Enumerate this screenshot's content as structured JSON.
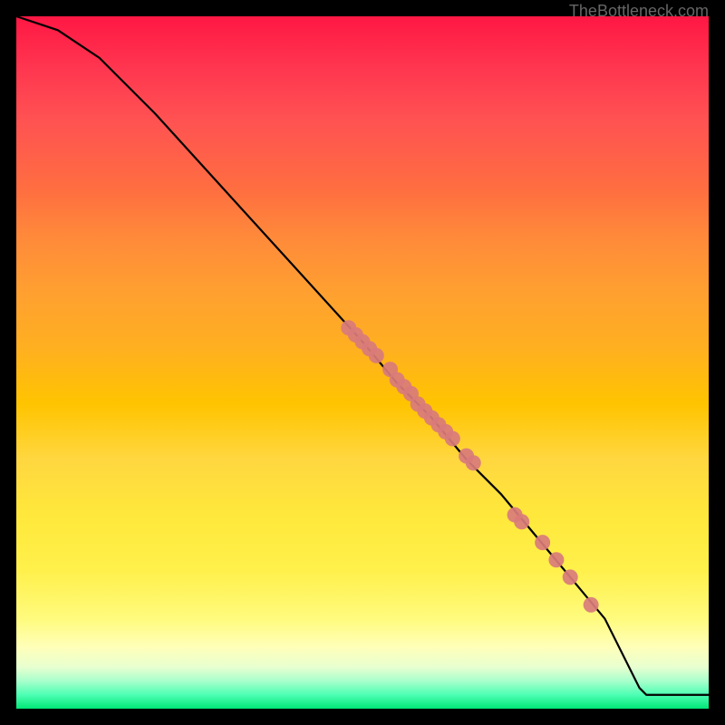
{
  "watermark": "TheBottleneck.com",
  "chart_data": {
    "type": "line",
    "title": "",
    "xlabel": "",
    "ylabel": "",
    "xlim": [
      0,
      100
    ],
    "ylim": [
      0,
      100
    ],
    "line": {
      "x": [
        0,
        6,
        12,
        20,
        30,
        40,
        50,
        55,
        60,
        65,
        70,
        75,
        80,
        85,
        90,
        91,
        100
      ],
      "y": [
        100,
        98,
        94,
        86,
        75,
        64,
        53,
        47,
        42,
        36,
        31,
        25,
        19,
        13,
        3,
        2,
        2
      ]
    },
    "points": [
      {
        "x": 48,
        "y": 55
      },
      {
        "x": 49,
        "y": 54
      },
      {
        "x": 50,
        "y": 53
      },
      {
        "x": 51,
        "y": 52
      },
      {
        "x": 52,
        "y": 51
      },
      {
        "x": 54,
        "y": 49
      },
      {
        "x": 55,
        "y": 47.5
      },
      {
        "x": 56,
        "y": 46.5
      },
      {
        "x": 57,
        "y": 45.5
      },
      {
        "x": 58,
        "y": 44
      },
      {
        "x": 59,
        "y": 43
      },
      {
        "x": 60,
        "y": 42
      },
      {
        "x": 61,
        "y": 41
      },
      {
        "x": 62,
        "y": 40
      },
      {
        "x": 63,
        "y": 39
      },
      {
        "x": 65,
        "y": 36.5
      },
      {
        "x": 66,
        "y": 35.5
      },
      {
        "x": 72,
        "y": 28
      },
      {
        "x": 73,
        "y": 27
      },
      {
        "x": 76,
        "y": 24
      },
      {
        "x": 78,
        "y": 21.5
      },
      {
        "x": 80,
        "y": 19
      },
      {
        "x": 83,
        "y": 15
      }
    ],
    "point_color": "#d97b7b",
    "line_color": "#000000"
  }
}
